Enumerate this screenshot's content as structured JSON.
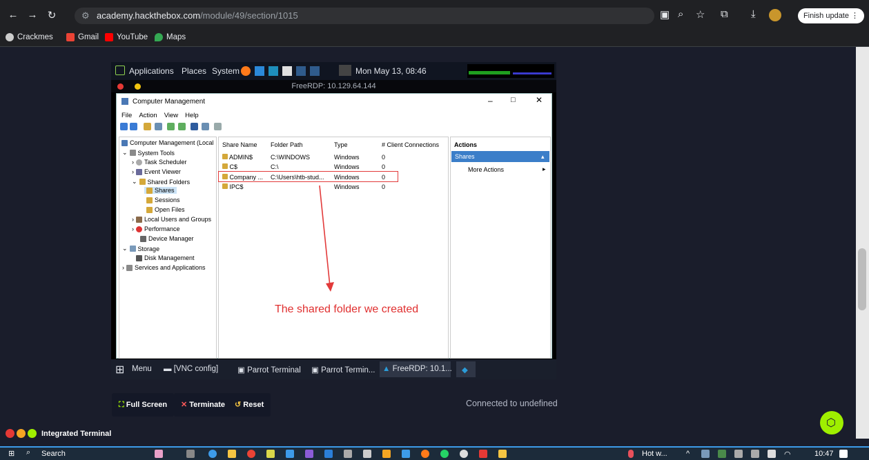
{
  "browser": {
    "url_host": "academy.hackthebox.com",
    "url_path": "/module/49/section/1015",
    "finish_update": "Finish update",
    "bookmarks": [
      "Crackmes",
      "Gmail",
      "YouTube",
      "Maps"
    ]
  },
  "parrot": {
    "menus": [
      "Applications",
      "Places",
      "System"
    ],
    "clock": "Mon May 13, 08:46",
    "rdp_title": "FreeRDP: 10.129.64.144"
  },
  "app": {
    "title": "Computer Management",
    "menu": [
      "File",
      "Action",
      "View",
      "Help"
    ],
    "tree": [
      "Computer Management (Local",
      "System Tools",
      "Task Scheduler",
      "Event Viewer",
      "Shared Folders",
      "Shares",
      "Sessions",
      "Open Files",
      "Local Users and Groups",
      "Performance",
      "Device Manager",
      "Storage",
      "Disk Management",
      "Services and Applications"
    ],
    "columns": [
      "Share Name",
      "Folder Path",
      "Type",
      "# Client Connections"
    ],
    "rows": [
      [
        "ADMIN$",
        "C:\\WINDOWS",
        "Windows",
        "0"
      ],
      [
        "C$",
        "C:\\",
        "Windows",
        "0"
      ],
      [
        "Company ...",
        "C:\\Users\\htb-stud...",
        "Windows",
        "0"
      ],
      [
        "IPC$",
        "",
        "Windows",
        "0"
      ]
    ],
    "actions_header": "Actions",
    "actions_shares": "Shares",
    "more_actions": "More Actions",
    "annotation": "The shared folder we created"
  },
  "parrot_taskbar": [
    "Menu",
    "[VNC config]",
    "Parrot Terminal",
    "Parrot Termin...",
    "FreeRDP: 10.1..."
  ],
  "page": {
    "full_screen": "Full Screen",
    "terminate": "Terminate",
    "reset": "Reset",
    "connected": "Connected to undefined",
    "integrated_terminal": "Integrated Terminal"
  },
  "windows_taskbar": {
    "search": "Search",
    "weather": "Hot w...",
    "time": "10:47"
  },
  "colors": {
    "accent_green": "#9fef00",
    "highlight_red": "#e23a3a"
  }
}
